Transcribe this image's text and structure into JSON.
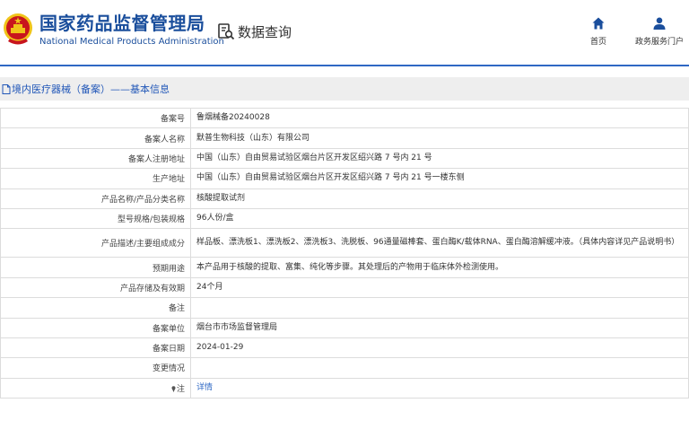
{
  "header": {
    "title_cn": "国家药品监督管理局",
    "title_en": "National Medical Products Administration",
    "query_label": "数据查询",
    "nav": {
      "home": "首页",
      "service": "政务服务门户"
    }
  },
  "section": {
    "title": "境内医疗器械（备案）——基本信息"
  },
  "rows": [
    {
      "label": "备案号",
      "value": "鲁烟械备20240028"
    },
    {
      "label": "备案人名称",
      "value": "默普生物科技（山东）有限公司"
    },
    {
      "label": "备案人注册地址",
      "value": "中国（山东）自由贸易试验区烟台片区开发区绍兴路 7 号内 21 号"
    },
    {
      "label": "生产地址",
      "value": "中国（山东）自由贸易试验区烟台片区开发区绍兴路 7 号内 21 号一楼东侧"
    },
    {
      "label": "产品名称/产品分类名称",
      "value": "核酸提取试剂"
    },
    {
      "label": "型号规格/包装规格",
      "value": "96人份/盒"
    },
    {
      "label": "产品描述/主要组成成分",
      "value": "样品板、漂洗板1、漂洗板2、漂洗板3、洗脱板、96通量磁棒套、蛋白酶K/载体RNA、蛋白酶溶解缓冲液。（具体内容详见产品说明书）"
    },
    {
      "label": "预期用途",
      "value": "本产品用于核酸的提取、富集、纯化等步骤。其处理后的产物用于临床体外检测使用。"
    },
    {
      "label": "产品存储及有效期",
      "value": "24个月"
    },
    {
      "label": "备注",
      "value": ""
    },
    {
      "label": "备案单位",
      "value": "烟台市市场监督管理局"
    },
    {
      "label": "备案日期",
      "value": "2024-01-29"
    },
    {
      "label": "变更情况",
      "value": ""
    },
    {
      "label": "注",
      "value": "详情"
    }
  ],
  "colors": {
    "brand": "#1a4e9c",
    "accent": "#2f68c4",
    "emblem_red": "#c8161d",
    "emblem_gold": "#f0c419"
  },
  "icons": [
    "national-emblem-icon",
    "search-document-icon",
    "home-icon",
    "user-icon",
    "document-icon",
    "pin-icon"
  ]
}
